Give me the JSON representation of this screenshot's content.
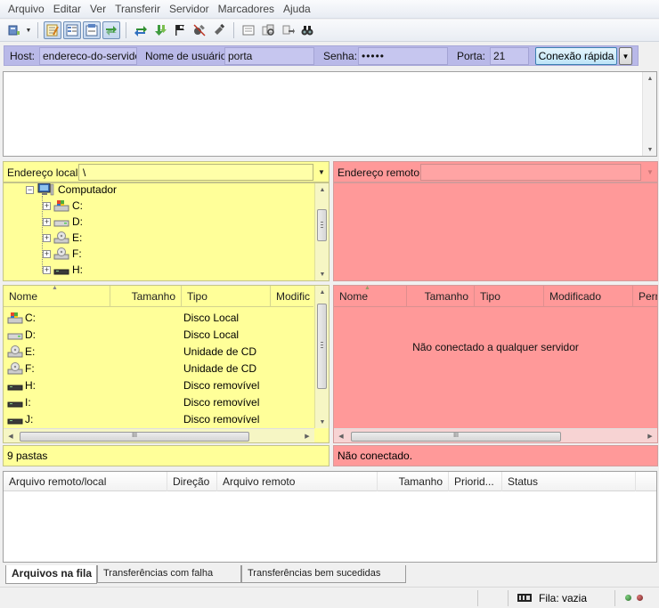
{
  "menu": [
    "Arquivo",
    "Editar",
    "Ver",
    "Transferir",
    "Servidor",
    "Marcadores",
    "Ajuda"
  ],
  "toolbar": {
    "icons": [
      "site-manager-icon",
      "toggle-log-icon",
      "toggle-local-tree-icon",
      "toggle-remote-tree-icon",
      "toggle-queue-icon",
      "refresh-icon",
      "process-queue-icon",
      "cancel-icon",
      "disconnect-icon",
      "reconnect-icon",
      "filter-icon",
      "compare-icon",
      "sync-browse-icon",
      "search-icon"
    ]
  },
  "quickconnect": {
    "host_label": "Host:",
    "host_value": "endereco-do-servidor",
    "user_label": "Nome de usuário:",
    "user_value": "porta",
    "password_label": "Senha:",
    "password_value": "•••••",
    "port_label": "Porta:",
    "port_value": "21",
    "button_label": "Conexão rápida"
  },
  "local": {
    "address_label": "Endereço local:",
    "address_value": "\\",
    "tree": {
      "root": "Computador",
      "drives": [
        "C:",
        "D:",
        "E:",
        "F:",
        "H:"
      ]
    },
    "columns": [
      "Nome",
      "Tamanho",
      "Tipo",
      "Modific"
    ],
    "files": [
      {
        "name": "C:",
        "type": "Disco Local",
        "icon": "hard-drive-icon"
      },
      {
        "name": "D:",
        "type": "Disco Local",
        "icon": "hard-drive-icon"
      },
      {
        "name": "E:",
        "type": "Unidade de CD",
        "icon": "cd-drive-icon"
      },
      {
        "name": "F:",
        "type": "Unidade de CD",
        "icon": "cd-drive-icon"
      },
      {
        "name": "H:",
        "type": "Disco removível",
        "icon": "removable-drive-icon"
      },
      {
        "name": "I:",
        "type": "Disco removível",
        "icon": "removable-drive-icon"
      },
      {
        "name": "J:",
        "type": "Disco removível",
        "icon": "removable-drive-icon"
      }
    ],
    "status": "9 pastas",
    "hscroll_thumb": "III"
  },
  "remote": {
    "address_label": "Endereço remoto:",
    "columns": [
      "Nome",
      "Tamanho",
      "Tipo",
      "Modificado",
      "Perr"
    ],
    "empty_message": "Não conectado a qualquer servidor",
    "status": "Não conectado.",
    "hscroll_thumb": "III"
  },
  "queue": {
    "columns": [
      "Arquivo remoto/local",
      "Direção",
      "Arquivo remoto",
      "Tamanho",
      "Priorid...",
      "Status"
    ]
  },
  "tabs": [
    "Arquivos na fila",
    "Transferências com falha",
    "Transferências bem sucedidas"
  ],
  "statusbar": {
    "queue_text": "Fila: vazia"
  },
  "colors": {
    "local_bg": "#ffff99",
    "remote_bg": "#ff9999",
    "quickconnect_bg": "#b9b9e8"
  }
}
